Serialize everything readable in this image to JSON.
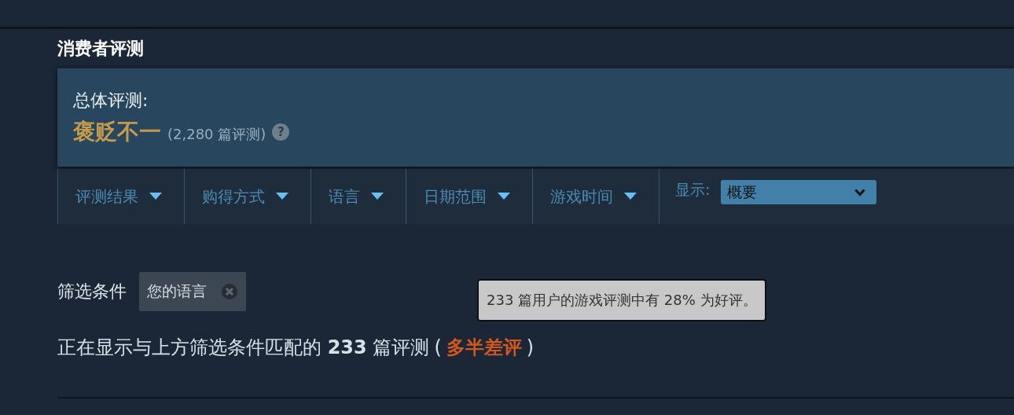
{
  "section_title": "消费者评测",
  "overall": {
    "label": "总体评测:",
    "rating": "褒贬不一",
    "count": "(2,280 篇评测)",
    "help": "?"
  },
  "filters": [
    {
      "label": "评测结果"
    },
    {
      "label": "购得方式"
    },
    {
      "label": "语言"
    },
    {
      "label": "日期范围"
    },
    {
      "label": "游戏时间"
    }
  ],
  "display": {
    "label": "显示:",
    "value": "概要"
  },
  "active_filters": {
    "label": "筛选条件",
    "chips": [
      {
        "label": "您的语言"
      }
    ]
  },
  "tooltip": "233 篇用户的游戏评测中有 28% 为好评。",
  "summary": {
    "text": "正在显示与上方筛选条件匹配的 **233** 篇评测",
    "open": "(",
    "rating": "多半差评",
    "close": ")"
  }
}
